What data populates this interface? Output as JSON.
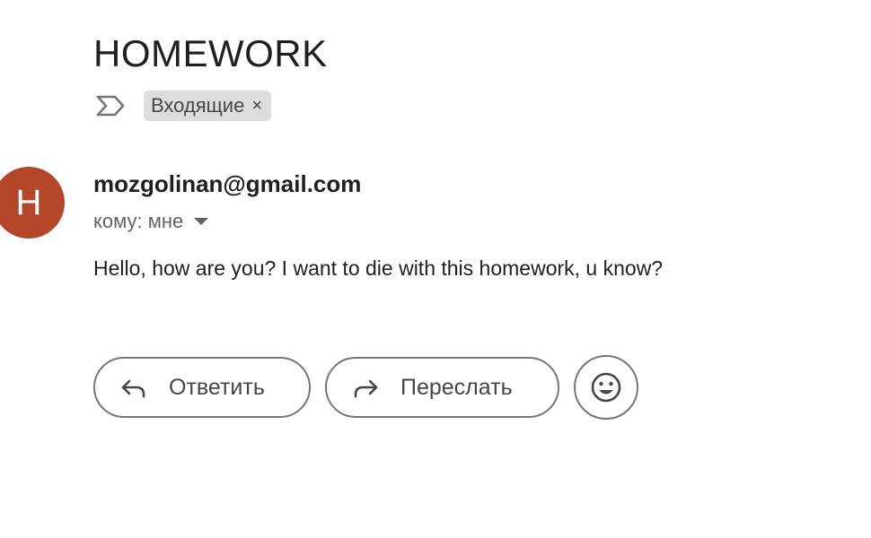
{
  "email": {
    "subject": "HOMEWORK",
    "label": "Входящие",
    "label_remove_glyph": "×",
    "sender": {
      "avatar_letter": "H",
      "avatar_color": "#b5462a",
      "email": "mozgolinan@gmail.com",
      "recipient_text": "кому: мне"
    },
    "body": "Hello, how are you? I want to die with this homework, u know?"
  },
  "actions": {
    "reply_label": "Ответить",
    "forward_label": "Переслать",
    "emoji_icon": "smiley-face-icon"
  },
  "icons": {
    "importance": "importance-marker-icon",
    "reply": "reply-arrow-icon",
    "forward": "forward-arrow-icon",
    "details": "caret-down-icon"
  },
  "colors": {
    "chip_background": "#dddddd",
    "button_border": "#747775",
    "secondary_text": "#5f6368"
  }
}
